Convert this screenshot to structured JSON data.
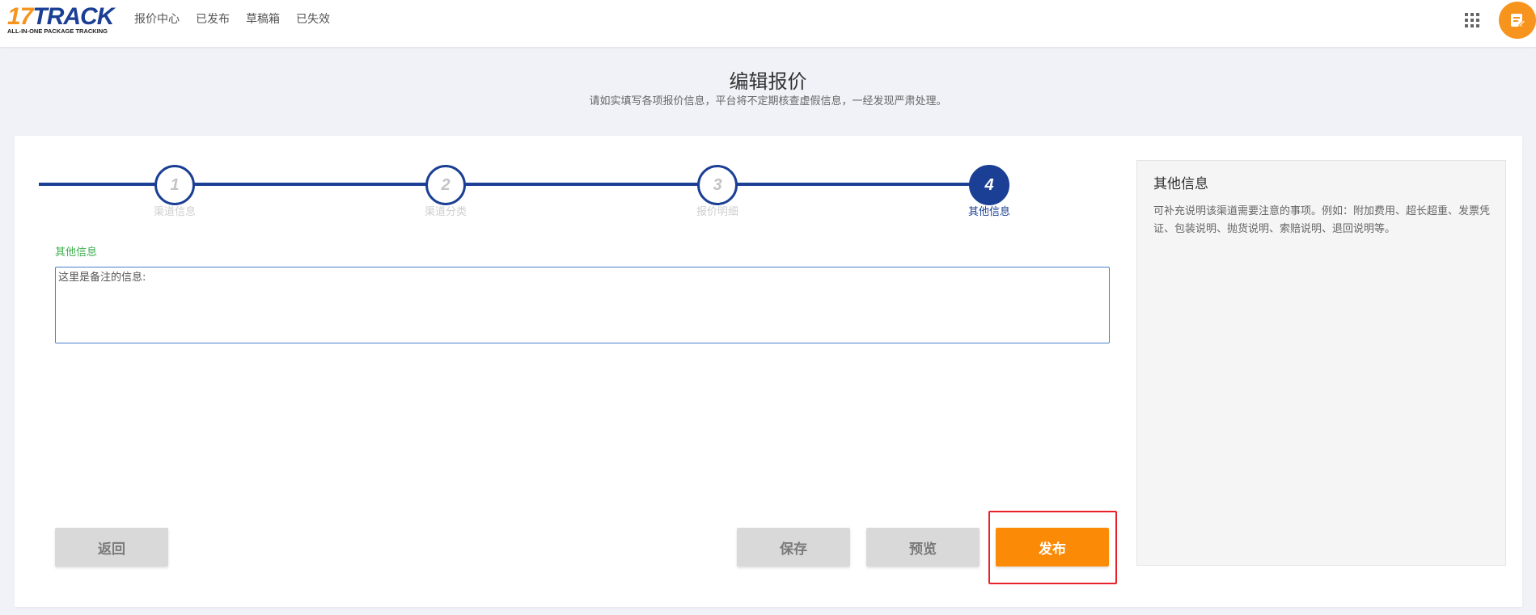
{
  "brand": {
    "logo_main": "17TRACK",
    "logo_sub": "ALL-IN-ONE PACKAGE TRACKING",
    "colors": {
      "blue": "#1b3f94",
      "orange": "#f7941d"
    }
  },
  "nav": {
    "items": [
      {
        "label": "报价中心"
      },
      {
        "label": "已发布"
      },
      {
        "label": "草稿箱"
      },
      {
        "label": "已失效"
      }
    ],
    "apps_icon": "grid-icon",
    "avatar_icon": "note-icon"
  },
  "header": {
    "title": "编辑报价",
    "subtitle": "请如实填写各项报价信息，平台将不定期核查虚假信息，一经发现严肃处理。"
  },
  "stepper": {
    "current_step": 4,
    "steps": [
      {
        "number": "1",
        "label": "渠道信息"
      },
      {
        "number": "2",
        "label": "渠道分类"
      },
      {
        "number": "3",
        "label": "报价明细"
      },
      {
        "number": "4",
        "label": "其他信息"
      }
    ]
  },
  "form": {
    "field_label": "其他信息",
    "notes_value": "这里是备注的信息:"
  },
  "actions": {
    "back_label": "返回",
    "save_label": "保存",
    "preview_label": "预览",
    "publish_label": "发布",
    "highlight_color": "#e8202a"
  },
  "side_panel": {
    "title": "其他信息",
    "description": "可补充说明该渠道需要注意的事项。例如：附加费用、超长超重、发票凭证、包装说明、抛货说明、索赔说明、退回说明等。"
  }
}
